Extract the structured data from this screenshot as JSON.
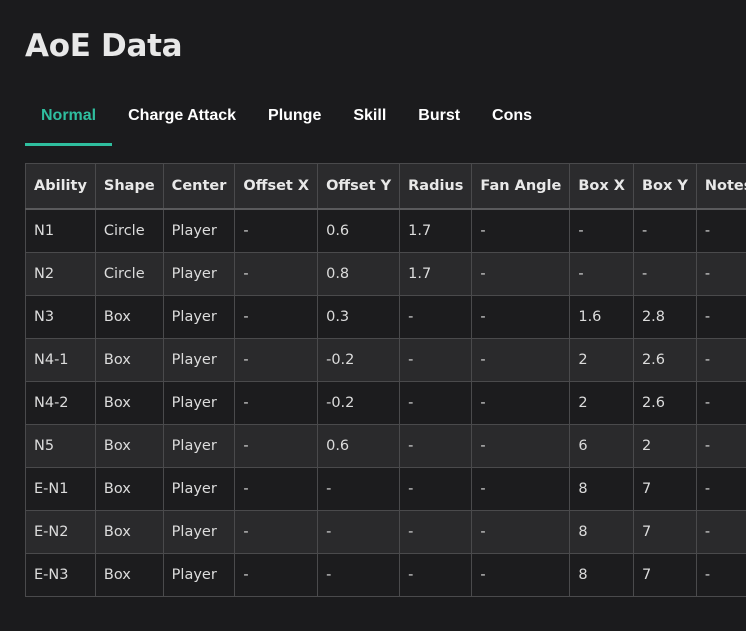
{
  "page": {
    "title": "AoE Data"
  },
  "tabs": [
    {
      "label": "Normal",
      "active": true
    },
    {
      "label": "Charge Attack",
      "active": false
    },
    {
      "label": "Plunge",
      "active": false
    },
    {
      "label": "Skill",
      "active": false
    },
    {
      "label": "Burst",
      "active": false
    },
    {
      "label": "Cons",
      "active": false
    }
  ],
  "colors": {
    "accent": "#2fbf9f",
    "background": "#1b1b1d"
  },
  "table": {
    "headers": [
      "Ability",
      "Shape",
      "Center",
      "Offset X",
      "Offset Y",
      "Radius",
      "Fan Angle",
      "Box X",
      "Box Y",
      "Notes"
    ],
    "rows": [
      [
        "N1",
        "Circle",
        "Player",
        "-",
        "0.6",
        "1.7",
        "-",
        "-",
        "-",
        "-"
      ],
      [
        "N2",
        "Circle",
        "Player",
        "-",
        "0.8",
        "1.7",
        "-",
        "-",
        "-",
        "-"
      ],
      [
        "N3",
        "Box",
        "Player",
        "-",
        "0.3",
        "-",
        "-",
        "1.6",
        "2.8",
        "-"
      ],
      [
        "N4-1",
        "Box",
        "Player",
        "-",
        "-0.2",
        "-",
        "-",
        "2",
        "2.6",
        "-"
      ],
      [
        "N4-2",
        "Box",
        "Player",
        "-",
        "-0.2",
        "-",
        "-",
        "2",
        "2.6",
        "-"
      ],
      [
        "N5",
        "Box",
        "Player",
        "-",
        "0.6",
        "-",
        "-",
        "6",
        "2",
        "-"
      ],
      [
        "E-N1",
        "Box",
        "Player",
        "-",
        "-",
        "-",
        "-",
        "8",
        "7",
        "-"
      ],
      [
        "E-N2",
        "Box",
        "Player",
        "-",
        "-",
        "-",
        "-",
        "8",
        "7",
        "-"
      ],
      [
        "E-N3",
        "Box",
        "Player",
        "-",
        "-",
        "-",
        "-",
        "8",
        "7",
        "-"
      ]
    ]
  }
}
